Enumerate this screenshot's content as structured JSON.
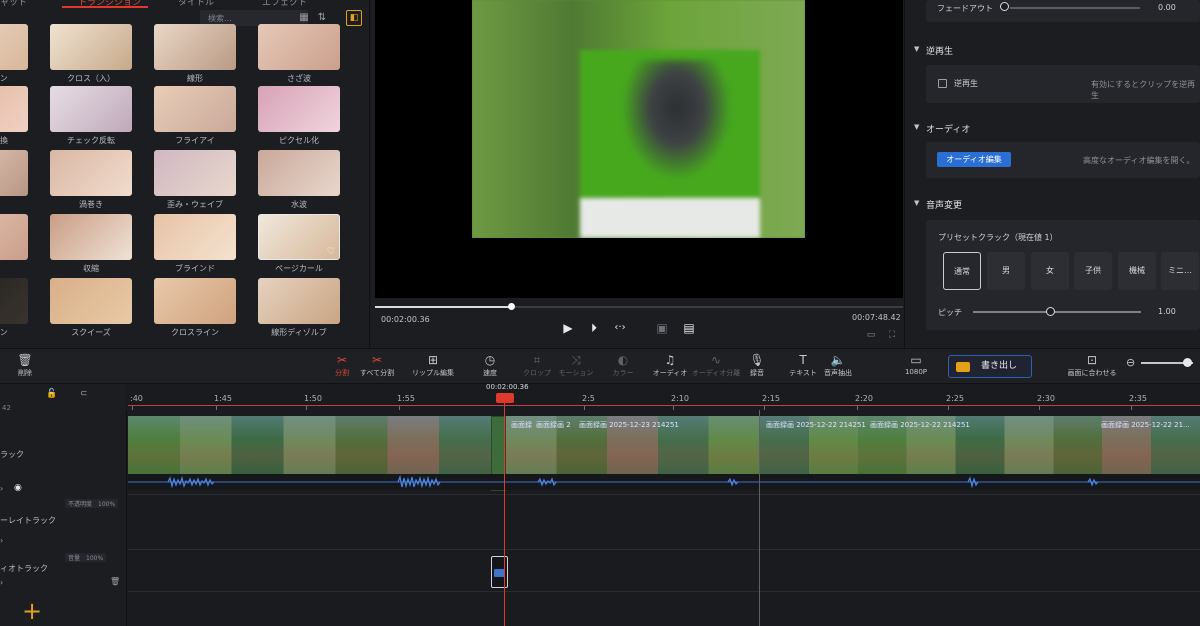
{
  "tabs": {
    "left_partial": "トランジション",
    "center": "タイトル",
    "right": "エフェクト"
  },
  "search_placeholder": "検索...",
  "transitions": [
    {
      "label": "ーン",
      "col": 0,
      "row": 0
    },
    {
      "label": "クロス（入）",
      "col": 1,
      "row": 0
    },
    {
      "label": "線形",
      "col": 2,
      "row": 0
    },
    {
      "label": "さざ波",
      "col": 3,
      "row": 0
    },
    {
      "label": "変換",
      "col": 0,
      "row": 1
    },
    {
      "label": "チェック反転",
      "col": 1,
      "row": 1
    },
    {
      "label": "フライアイ",
      "col": 2,
      "row": 1
    },
    {
      "label": "ピクセル化",
      "col": 3,
      "row": 1
    },
    {
      "label": "",
      "col": 0,
      "row": 2
    },
    {
      "label": "渦巻き",
      "col": 1,
      "row": 2
    },
    {
      "label": "歪み・ウェイブ",
      "col": 2,
      "row": 2
    },
    {
      "label": "水波",
      "col": 3,
      "row": 2
    },
    {
      "label": "",
      "col": 0,
      "row": 3
    },
    {
      "label": "収縮",
      "col": 1,
      "row": 3
    },
    {
      "label": "ブラインド",
      "col": 2,
      "row": 3
    },
    {
      "label": "ページカール",
      "col": 3,
      "row": 3
    },
    {
      "label": "ーン",
      "col": 0,
      "row": 4
    },
    {
      "label": "スクイーズ",
      "col": 1,
      "row": 4
    },
    {
      "label": "クロスライン",
      "col": 2,
      "row": 4
    },
    {
      "label": "線形ディゾルブ",
      "col": 3,
      "row": 4
    }
  ],
  "preview": {
    "current_time": "00:02:00.36",
    "total_time": "00:07:48.42",
    "progress": 0.258
  },
  "inspector": {
    "fadeout_label": "フェードアウト",
    "fadeout_value": "0.00",
    "reverse_section": "逆再生",
    "reverse_checkbox": "逆再生",
    "reverse_hint": "有効にするとクリップを逆再生",
    "audio_section": "オーディオ",
    "audio_edit_button": "オーディオ編集",
    "audio_hint": "高度なオーディオ編集を開く。",
    "voice_section": "音声変更",
    "preset_label": "プリセットクラック（現在値 1）",
    "presets": [
      "通常",
      "男",
      "女",
      "子供",
      "機械",
      "ミニ…"
    ],
    "pitch_label": "ピッチ",
    "pitch_value": "1.00"
  },
  "toolbar": {
    "delete": "削除",
    "split": "分割",
    "split_all": "すべて分割",
    "ripple": "リップル編集",
    "speed": "速度",
    "crop": "クロップ",
    "motion": "モーション",
    "color": "カラー",
    "audio": "オーディオ",
    "audio_split": "オーディオ分離",
    "record": "録音",
    "text": "テキスト",
    "voice_extract": "音声抽出",
    "resolution": "1080P",
    "export": "書き出し",
    "fit": "画面に合わせる"
  },
  "timeline": {
    "playhead_tc": "00:02:00.36",
    "ticks": [
      ":40",
      "1:45",
      "1:50",
      "1:55",
      "2:5",
      "2:10",
      "2:15",
      "2:20",
      "2:25",
      "2:30",
      "2:35"
    ],
    "left_edge": "42",
    "track_main": "ラック",
    "track_overlay": "ーレイトラック",
    "track_audio": "ィオトラック",
    "opacity_badge": "不透明度　100%",
    "volume_badge": "音量　100%",
    "clip_labels": [
      "画面録",
      "画面録画 2",
      "画面録画 2025-12-23 214251",
      "画面録画 2025-12-22 214251",
      "画面録画 2025-12-22 214251",
      "画面録画 2025-12-22 21..."
    ]
  },
  "colors": {
    "accent_red": "#e0392c",
    "accent_orange": "#e3a11a",
    "accent_blue": "#2a6fd6",
    "bg": "#1a1b1e"
  }
}
